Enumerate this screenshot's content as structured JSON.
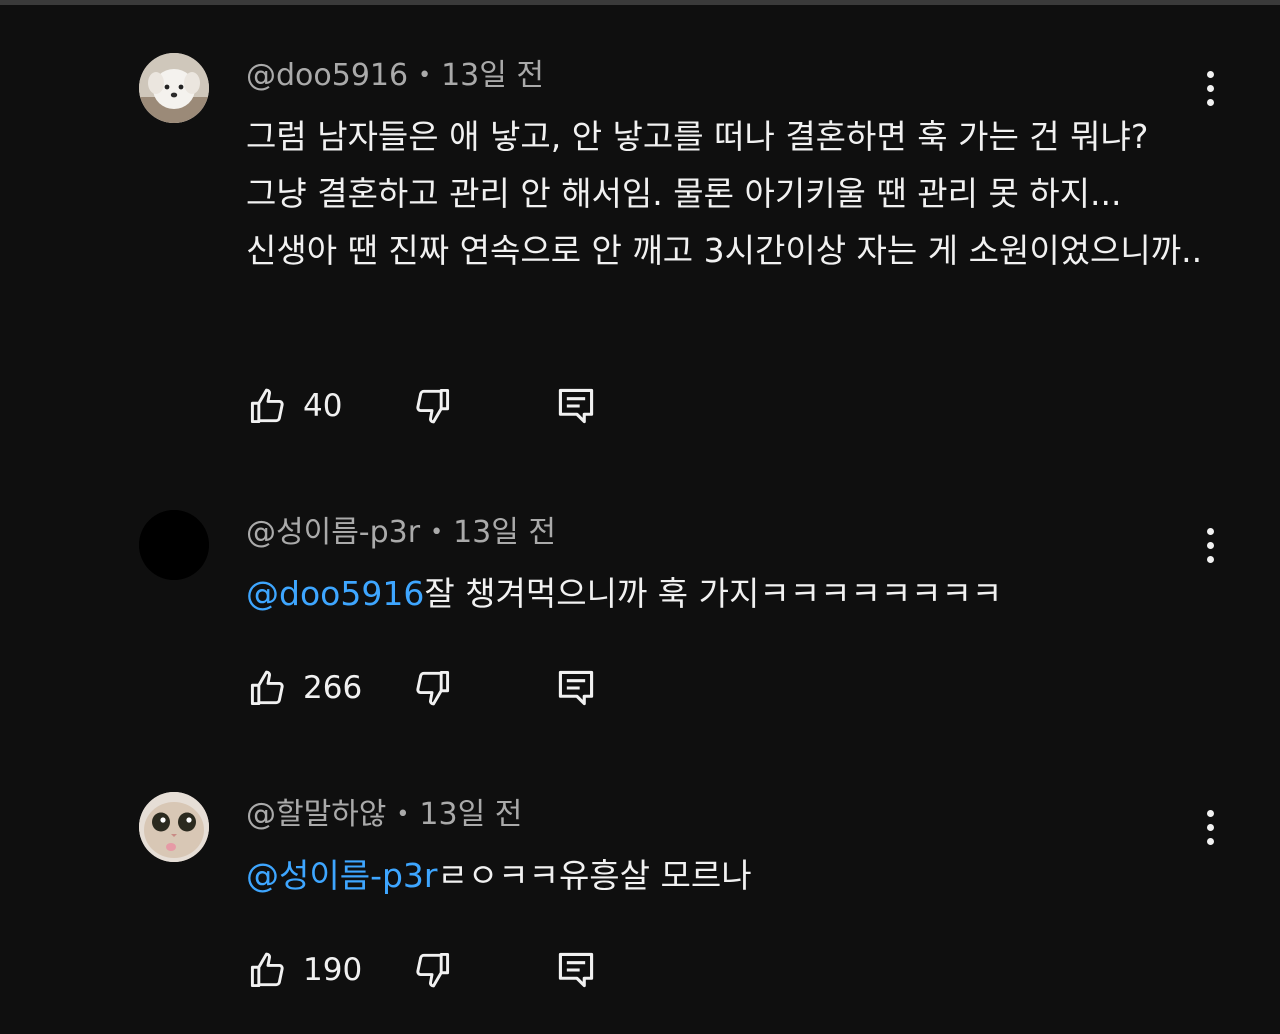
{
  "comments": [
    {
      "author": "@doo5916",
      "age": "13일 전",
      "mention": "",
      "text": "그럼 남자들은 애 낳고, 안 낳고를 떠나 결혼하면 훅 가는 건 뭐냐? 그냥 결혼하고 관리 안 해서임. 물론 아기키울 땐 관리 못 하지...신생아 땐 진짜 연속으로 안 깨고 3시간이상 자는 게 소원이었으니까..",
      "likes": "40",
      "avatar_icon": "white-puppy-avatar"
    },
    {
      "author": "@성이름-p3r",
      "age": "13일 전",
      "mention": "@doo5916",
      "text": "잘 챙겨먹으니까 훅 가지ㅋㅋㅋㅋㅋㅋㅋㅋ",
      "likes": "266",
      "avatar_icon": "black-circle-avatar"
    },
    {
      "author": "@할말하않",
      "age": "13일 전",
      "mention": "@성이름-p3r",
      "text": "ㄹㅇㅋㅋ유흥살 모르나",
      "likes": "190",
      "avatar_icon": "cat-face-avatar"
    }
  ],
  "icons": {
    "like": "thumbs-up-icon",
    "dislike": "thumbs-down-icon",
    "reply": "reply-icon",
    "more": "more-vert-icon"
  },
  "colors": {
    "background": "#0f0f0f",
    "text": "#f1f1f1",
    "meta": "#aaaaaa",
    "mention": "#3ea6ff"
  }
}
